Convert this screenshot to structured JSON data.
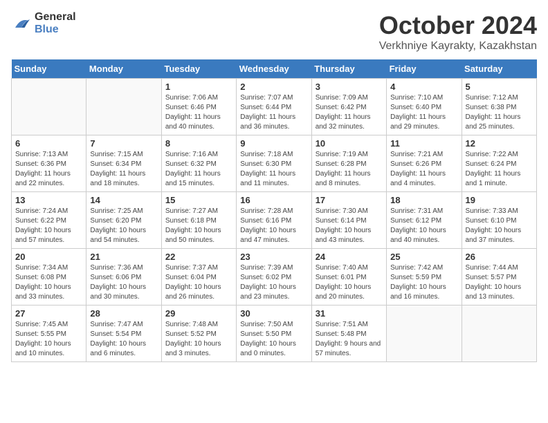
{
  "logo": {
    "line1": "General",
    "line2": "Blue"
  },
  "title": "October 2024",
  "location": "Verkhniye Kayrakty, Kazakhstan",
  "days_header": [
    "Sunday",
    "Monday",
    "Tuesday",
    "Wednesday",
    "Thursday",
    "Friday",
    "Saturday"
  ],
  "weeks": [
    [
      {
        "day": "",
        "sunrise": "",
        "sunset": "",
        "daylight": ""
      },
      {
        "day": "",
        "sunrise": "",
        "sunset": "",
        "daylight": ""
      },
      {
        "day": "1",
        "sunrise": "Sunrise: 7:06 AM",
        "sunset": "Sunset: 6:46 PM",
        "daylight": "Daylight: 11 hours and 40 minutes."
      },
      {
        "day": "2",
        "sunrise": "Sunrise: 7:07 AM",
        "sunset": "Sunset: 6:44 PM",
        "daylight": "Daylight: 11 hours and 36 minutes."
      },
      {
        "day": "3",
        "sunrise": "Sunrise: 7:09 AM",
        "sunset": "Sunset: 6:42 PM",
        "daylight": "Daylight: 11 hours and 32 minutes."
      },
      {
        "day": "4",
        "sunrise": "Sunrise: 7:10 AM",
        "sunset": "Sunset: 6:40 PM",
        "daylight": "Daylight: 11 hours and 29 minutes."
      },
      {
        "day": "5",
        "sunrise": "Sunrise: 7:12 AM",
        "sunset": "Sunset: 6:38 PM",
        "daylight": "Daylight: 11 hours and 25 minutes."
      }
    ],
    [
      {
        "day": "6",
        "sunrise": "Sunrise: 7:13 AM",
        "sunset": "Sunset: 6:36 PM",
        "daylight": "Daylight: 11 hours and 22 minutes."
      },
      {
        "day": "7",
        "sunrise": "Sunrise: 7:15 AM",
        "sunset": "Sunset: 6:34 PM",
        "daylight": "Daylight: 11 hours and 18 minutes."
      },
      {
        "day": "8",
        "sunrise": "Sunrise: 7:16 AM",
        "sunset": "Sunset: 6:32 PM",
        "daylight": "Daylight: 11 hours and 15 minutes."
      },
      {
        "day": "9",
        "sunrise": "Sunrise: 7:18 AM",
        "sunset": "Sunset: 6:30 PM",
        "daylight": "Daylight: 11 hours and 11 minutes."
      },
      {
        "day": "10",
        "sunrise": "Sunrise: 7:19 AM",
        "sunset": "Sunset: 6:28 PM",
        "daylight": "Daylight: 11 hours and 8 minutes."
      },
      {
        "day": "11",
        "sunrise": "Sunrise: 7:21 AM",
        "sunset": "Sunset: 6:26 PM",
        "daylight": "Daylight: 11 hours and 4 minutes."
      },
      {
        "day": "12",
        "sunrise": "Sunrise: 7:22 AM",
        "sunset": "Sunset: 6:24 PM",
        "daylight": "Daylight: 11 hours and 1 minute."
      }
    ],
    [
      {
        "day": "13",
        "sunrise": "Sunrise: 7:24 AM",
        "sunset": "Sunset: 6:22 PM",
        "daylight": "Daylight: 10 hours and 57 minutes."
      },
      {
        "day": "14",
        "sunrise": "Sunrise: 7:25 AM",
        "sunset": "Sunset: 6:20 PM",
        "daylight": "Daylight: 10 hours and 54 minutes."
      },
      {
        "day": "15",
        "sunrise": "Sunrise: 7:27 AM",
        "sunset": "Sunset: 6:18 PM",
        "daylight": "Daylight: 10 hours and 50 minutes."
      },
      {
        "day": "16",
        "sunrise": "Sunrise: 7:28 AM",
        "sunset": "Sunset: 6:16 PM",
        "daylight": "Daylight: 10 hours and 47 minutes."
      },
      {
        "day": "17",
        "sunrise": "Sunrise: 7:30 AM",
        "sunset": "Sunset: 6:14 PM",
        "daylight": "Daylight: 10 hours and 43 minutes."
      },
      {
        "day": "18",
        "sunrise": "Sunrise: 7:31 AM",
        "sunset": "Sunset: 6:12 PM",
        "daylight": "Daylight: 10 hours and 40 minutes."
      },
      {
        "day": "19",
        "sunrise": "Sunrise: 7:33 AM",
        "sunset": "Sunset: 6:10 PM",
        "daylight": "Daylight: 10 hours and 37 minutes."
      }
    ],
    [
      {
        "day": "20",
        "sunrise": "Sunrise: 7:34 AM",
        "sunset": "Sunset: 6:08 PM",
        "daylight": "Daylight: 10 hours and 33 minutes."
      },
      {
        "day": "21",
        "sunrise": "Sunrise: 7:36 AM",
        "sunset": "Sunset: 6:06 PM",
        "daylight": "Daylight: 10 hours and 30 minutes."
      },
      {
        "day": "22",
        "sunrise": "Sunrise: 7:37 AM",
        "sunset": "Sunset: 6:04 PM",
        "daylight": "Daylight: 10 hours and 26 minutes."
      },
      {
        "day": "23",
        "sunrise": "Sunrise: 7:39 AM",
        "sunset": "Sunset: 6:02 PM",
        "daylight": "Daylight: 10 hours and 23 minutes."
      },
      {
        "day": "24",
        "sunrise": "Sunrise: 7:40 AM",
        "sunset": "Sunset: 6:01 PM",
        "daylight": "Daylight: 10 hours and 20 minutes."
      },
      {
        "day": "25",
        "sunrise": "Sunrise: 7:42 AM",
        "sunset": "Sunset: 5:59 PM",
        "daylight": "Daylight: 10 hours and 16 minutes."
      },
      {
        "day": "26",
        "sunrise": "Sunrise: 7:44 AM",
        "sunset": "Sunset: 5:57 PM",
        "daylight": "Daylight: 10 hours and 13 minutes."
      }
    ],
    [
      {
        "day": "27",
        "sunrise": "Sunrise: 7:45 AM",
        "sunset": "Sunset: 5:55 PM",
        "daylight": "Daylight: 10 hours and 10 minutes."
      },
      {
        "day": "28",
        "sunrise": "Sunrise: 7:47 AM",
        "sunset": "Sunset: 5:54 PM",
        "daylight": "Daylight: 10 hours and 6 minutes."
      },
      {
        "day": "29",
        "sunrise": "Sunrise: 7:48 AM",
        "sunset": "Sunset: 5:52 PM",
        "daylight": "Daylight: 10 hours and 3 minutes."
      },
      {
        "day": "30",
        "sunrise": "Sunrise: 7:50 AM",
        "sunset": "Sunset: 5:50 PM",
        "daylight": "Daylight: 10 hours and 0 minutes."
      },
      {
        "day": "31",
        "sunrise": "Sunrise: 7:51 AM",
        "sunset": "Sunset: 5:48 PM",
        "daylight": "Daylight: 9 hours and 57 minutes."
      },
      {
        "day": "",
        "sunrise": "",
        "sunset": "",
        "daylight": ""
      },
      {
        "day": "",
        "sunrise": "",
        "sunset": "",
        "daylight": ""
      }
    ]
  ]
}
